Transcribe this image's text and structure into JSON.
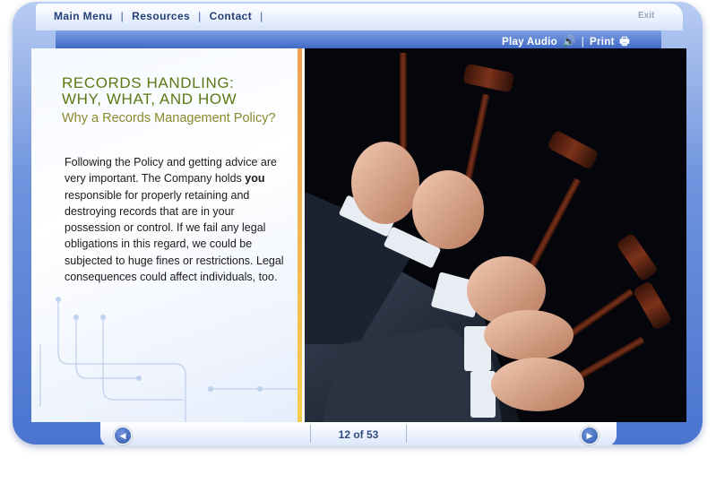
{
  "topnav": {
    "items": [
      "Main Menu",
      "Resources",
      "Contact"
    ],
    "exit_label": "Exit"
  },
  "toolbar": {
    "play_audio_label": "Play Audio",
    "print_label": "Print",
    "separator": "|"
  },
  "content": {
    "title_line1": "RECORDS HANDLING:",
    "title_line2": "WHY, WHAT, AND HOW",
    "subtitle": "Why a Records Management Policy?",
    "body_before": "Following the Policy and getting advice are very important. The Company holds ",
    "body_emphasis": "you",
    "body_after": " responsible for properly retaining and destroying records that are in your possession or control. If we fail any legal obligations in this regard, we could be subjected to huge fines or restrictions. Legal consequences could affect individuals, too."
  },
  "pagination": {
    "label": "12 of 53"
  },
  "colors": {
    "frame_blue": "#4a74cf",
    "heading_green": "#5a7a14",
    "subtitle_olive": "#8a8a2c",
    "nav_text": "#243f78",
    "divider_orange": "#f0a050"
  },
  "icons": [
    "speaker-icon",
    "printer-icon",
    "arrow-left-icon",
    "arrow-right-icon"
  ]
}
